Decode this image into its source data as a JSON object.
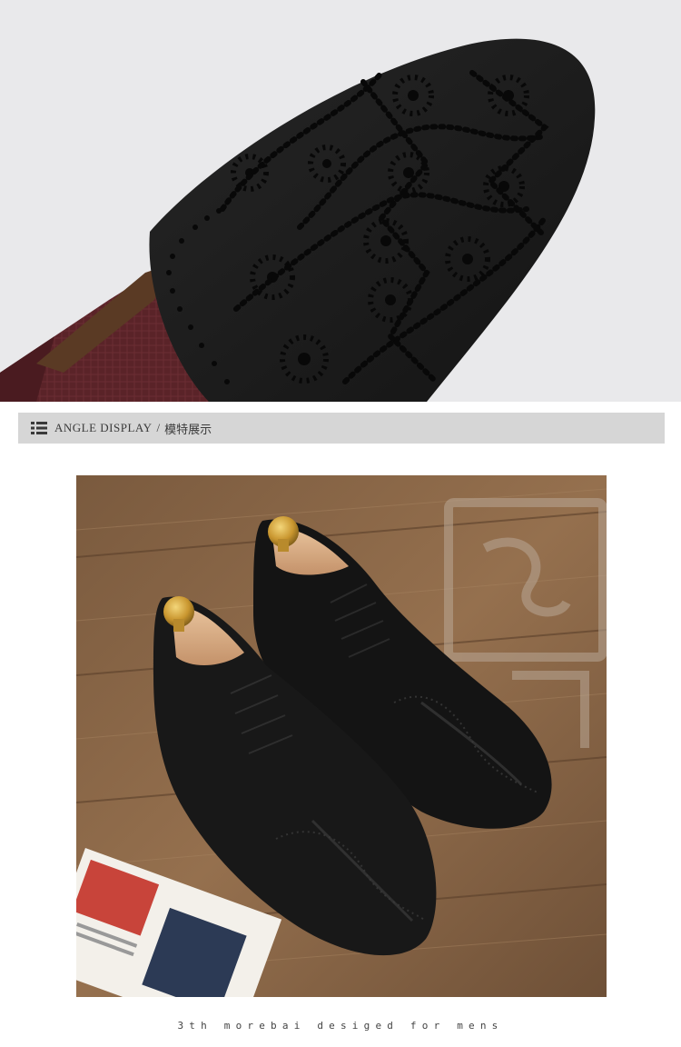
{
  "section_header": {
    "icon": "menu-icon",
    "title": "ANGLE DISPLAY",
    "separator": "/",
    "title_cn": "模特展示"
  },
  "images": {
    "top": "sole-photo",
    "main": "shoes-photo"
  },
  "tagline": "3th morebai desiged for mens",
  "colors": {
    "bar_bg": "#d6d6d6",
    "text": "#3a3a3a",
    "sole": "#1e1e1e",
    "wood": "#8a6646",
    "leather": "#161616"
  }
}
